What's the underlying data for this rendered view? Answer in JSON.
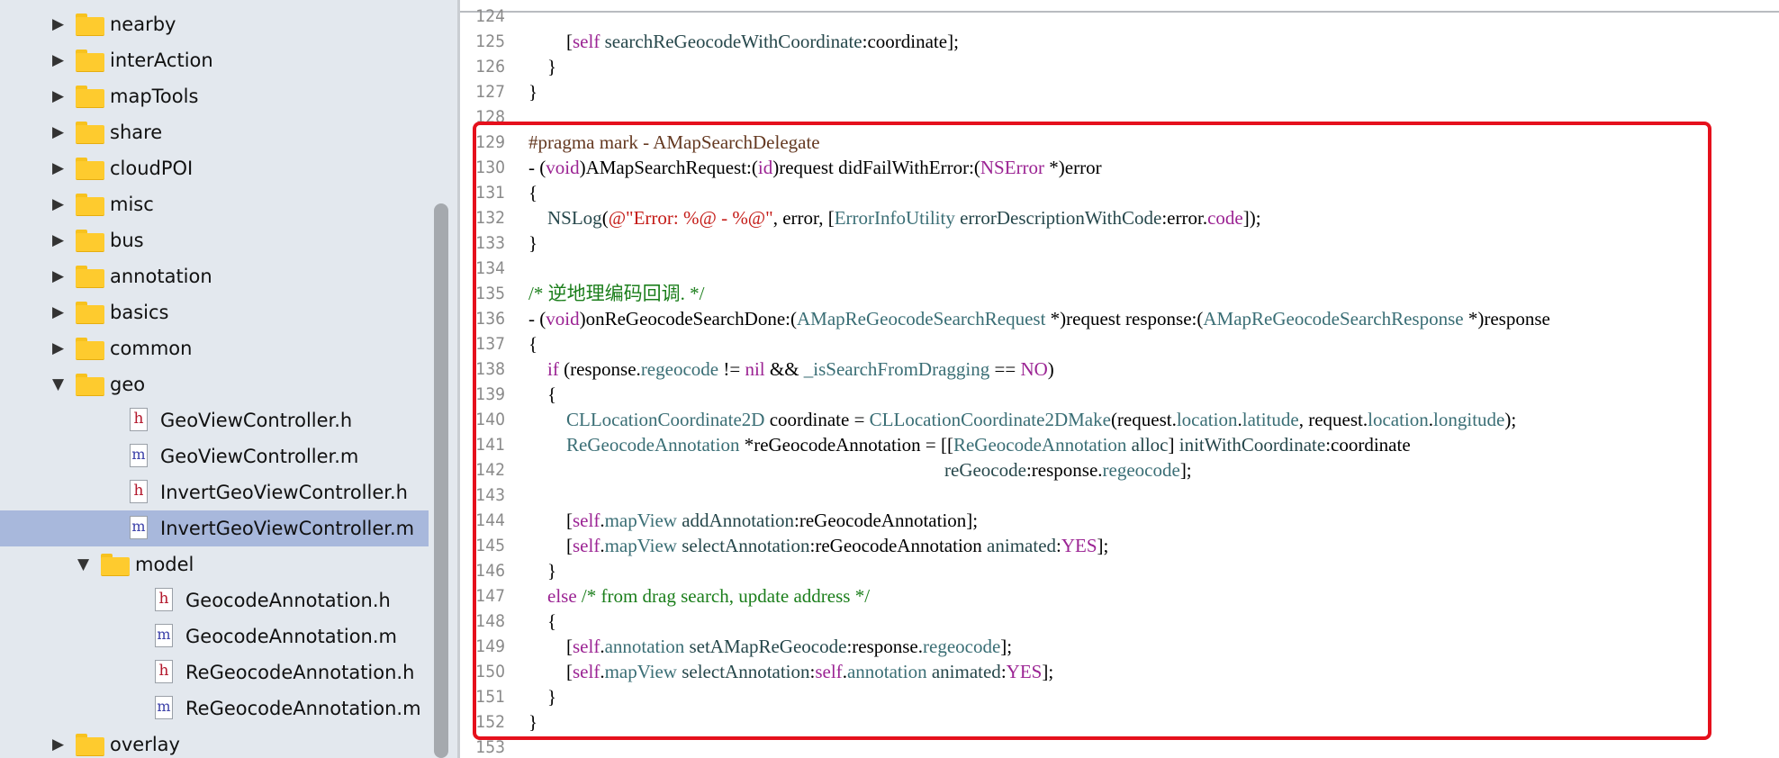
{
  "sidebar": {
    "items": [
      {
        "type": "folder",
        "label": "nearby",
        "expanded": false,
        "depth": 0
      },
      {
        "type": "folder",
        "label": "interAction",
        "expanded": false,
        "depth": 0
      },
      {
        "type": "folder",
        "label": "mapTools",
        "expanded": false,
        "depth": 0
      },
      {
        "type": "folder",
        "label": "share",
        "expanded": false,
        "depth": 0
      },
      {
        "type": "folder",
        "label": "cloudPOI",
        "expanded": false,
        "depth": 0
      },
      {
        "type": "folder",
        "label": "misc",
        "expanded": false,
        "depth": 0
      },
      {
        "type": "folder",
        "label": "bus",
        "expanded": false,
        "depth": 0
      },
      {
        "type": "folder",
        "label": "annotation",
        "expanded": false,
        "depth": 0
      },
      {
        "type": "folder",
        "label": "basics",
        "expanded": false,
        "depth": 0
      },
      {
        "type": "folder",
        "label": "common",
        "expanded": false,
        "depth": 0
      },
      {
        "type": "folder",
        "label": "geo",
        "expanded": true,
        "depth": 0
      },
      {
        "type": "file",
        "icon": "h",
        "label": "GeoViewController.h",
        "depth": 1
      },
      {
        "type": "file",
        "icon": "m",
        "label": "GeoViewController.m",
        "depth": 1
      },
      {
        "type": "file",
        "icon": "h",
        "label": "InvertGeoViewController.h",
        "depth": 1
      },
      {
        "type": "file",
        "icon": "m",
        "label": "InvertGeoViewController.m",
        "depth": 1,
        "selected": true
      },
      {
        "type": "folder",
        "label": "model",
        "expanded": true,
        "depth": 1
      },
      {
        "type": "file",
        "icon": "h",
        "label": "GeocodeAnnotation.h",
        "depth": 2
      },
      {
        "type": "file",
        "icon": "m",
        "label": "GeocodeAnnotation.m",
        "depth": 2
      },
      {
        "type": "file",
        "icon": "h",
        "label": "ReGeocodeAnnotation.h",
        "depth": 2
      },
      {
        "type": "file",
        "icon": "m",
        "label": "ReGeocodeAnnotation.m",
        "depth": 2
      },
      {
        "type": "folder",
        "label": "overlay",
        "expanded": false,
        "depth": 0
      }
    ]
  },
  "editor": {
    "lines": [
      {
        "n": "124",
        "tokens": []
      },
      {
        "n": "125",
        "tokens": [
          [
            "p",
            "        ["
          ],
          [
            "k",
            "self"
          ],
          [
            "p",
            " "
          ],
          [
            "f",
            "searchReGeocodeWithCoordinate"
          ],
          [
            "p",
            ":coordinate];"
          ]
        ]
      },
      {
        "n": "126",
        "tokens": [
          [
            "p",
            "    }"
          ]
        ]
      },
      {
        "n": "127",
        "tokens": [
          [
            "p",
            "}"
          ]
        ]
      },
      {
        "n": "128",
        "tokens": []
      },
      {
        "n": "129",
        "tokens": [
          [
            "r",
            "#pragma mark - AMapSearchDelegate"
          ]
        ]
      },
      {
        "n": "130",
        "tokens": [
          [
            "p",
            "- ("
          ],
          [
            "k",
            "void"
          ],
          [
            "p",
            ")AMapSearchRequest:("
          ],
          [
            "k",
            "id"
          ],
          [
            "p",
            ")request didFailWithError:("
          ],
          [
            "k",
            "NSError"
          ],
          [
            "p",
            " *)error"
          ]
        ]
      },
      {
        "n": "131",
        "tokens": [
          [
            "p",
            "{"
          ]
        ]
      },
      {
        "n": "132",
        "tokens": [
          [
            "p",
            "    "
          ],
          [
            "f",
            "NSLog"
          ],
          [
            "p",
            "("
          ],
          [
            "s",
            "@\"Error: %@ - %@\""
          ],
          [
            "p",
            ", error, ["
          ],
          [
            "c",
            "ErrorInfoUtility"
          ],
          [
            "p",
            " "
          ],
          [
            "f",
            "errorDescriptionWithCode"
          ],
          [
            "p",
            ":error."
          ],
          [
            "k",
            "code"
          ],
          [
            "p",
            "]);"
          ]
        ]
      },
      {
        "n": "133",
        "tokens": [
          [
            "p",
            "}"
          ]
        ]
      },
      {
        "n": "134",
        "tokens": []
      },
      {
        "n": "135",
        "tokens": [
          [
            "m",
            "/* 逆地理编码回调. */"
          ]
        ]
      },
      {
        "n": "136",
        "tokens": [
          [
            "p",
            "- ("
          ],
          [
            "k",
            "void"
          ],
          [
            "p",
            ")onReGeocodeSearchDone:("
          ],
          [
            "c",
            "AMapReGeocodeSearchRequest"
          ],
          [
            "p",
            " *)request response:("
          ],
          [
            "c",
            "AMapReGeocodeSearchResponse"
          ],
          [
            "p",
            " *)response"
          ]
        ]
      },
      {
        "n": "137",
        "tokens": [
          [
            "p",
            "{"
          ]
        ]
      },
      {
        "n": "138",
        "tokens": [
          [
            "p",
            "    "
          ],
          [
            "k",
            "if"
          ],
          [
            "p",
            " (response."
          ],
          [
            "c",
            "regeocode"
          ],
          [
            "p",
            " != "
          ],
          [
            "k",
            "nil"
          ],
          [
            "p",
            " && "
          ],
          [
            "c",
            "_isSearchFromDragging"
          ],
          [
            "p",
            " == "
          ],
          [
            "k",
            "NO"
          ],
          [
            "p",
            ")"
          ]
        ]
      },
      {
        "n": "139",
        "tokens": [
          [
            "p",
            "    {"
          ]
        ]
      },
      {
        "n": "140",
        "tokens": [
          [
            "p",
            "        "
          ],
          [
            "c",
            "CLLocationCoordinate2D"
          ],
          [
            "p",
            " coordinate = "
          ],
          [
            "c",
            "CLLocationCoordinate2DMake"
          ],
          [
            "p",
            "(request."
          ],
          [
            "c",
            "location"
          ],
          [
            "p",
            "."
          ],
          [
            "c",
            "latitude"
          ],
          [
            "p",
            ", request."
          ],
          [
            "c",
            "location"
          ],
          [
            "p",
            "."
          ],
          [
            "c",
            "longitude"
          ],
          [
            "p",
            ");"
          ]
        ]
      },
      {
        "n": "141",
        "tokens": [
          [
            "p",
            "        "
          ],
          [
            "c",
            "ReGeocodeAnnotation"
          ],
          [
            "p",
            " *reGeocodeAnnotation = [["
          ],
          [
            "c",
            "ReGeocodeAnnotation"
          ],
          [
            "p",
            " "
          ],
          [
            "f",
            "alloc"
          ],
          [
            "p",
            "] "
          ],
          [
            "f",
            "initWithCoordinate"
          ],
          [
            "p",
            ":coordinate"
          ]
        ]
      },
      {
        "n": "142",
        "tokens": [
          [
            "p",
            "                                                                                        "
          ],
          [
            "f",
            "reGeocode"
          ],
          [
            "p",
            ":response."
          ],
          [
            "c",
            "regeocode"
          ],
          [
            "p",
            "];"
          ]
        ]
      },
      {
        "n": "143",
        "tokens": []
      },
      {
        "n": "144",
        "tokens": [
          [
            "p",
            "        ["
          ],
          [
            "k",
            "self"
          ],
          [
            "p",
            "."
          ],
          [
            "c",
            "mapView"
          ],
          [
            "p",
            " "
          ],
          [
            "f",
            "addAnnotation"
          ],
          [
            "p",
            ":reGeocodeAnnotation];"
          ]
        ]
      },
      {
        "n": "145",
        "tokens": [
          [
            "p",
            "        ["
          ],
          [
            "k",
            "self"
          ],
          [
            "p",
            "."
          ],
          [
            "c",
            "mapView"
          ],
          [
            "p",
            " "
          ],
          [
            "f",
            "selectAnnotation"
          ],
          [
            "p",
            ":reGeocodeAnnotation "
          ],
          [
            "f",
            "animated"
          ],
          [
            "p",
            ":"
          ],
          [
            "k",
            "YES"
          ],
          [
            "p",
            "];"
          ]
        ]
      },
      {
        "n": "146",
        "tokens": [
          [
            "p",
            "    }"
          ]
        ]
      },
      {
        "n": "147",
        "tokens": [
          [
            "p",
            "    "
          ],
          [
            "k",
            "else"
          ],
          [
            "p",
            " "
          ],
          [
            "m",
            "/* from drag search, update address */"
          ]
        ]
      },
      {
        "n": "148",
        "tokens": [
          [
            "p",
            "    {"
          ]
        ]
      },
      {
        "n": "149",
        "tokens": [
          [
            "p",
            "        ["
          ],
          [
            "k",
            "self"
          ],
          [
            "p",
            "."
          ],
          [
            "c",
            "annotation"
          ],
          [
            "p",
            " "
          ],
          [
            "f",
            "setAMapReGeocode"
          ],
          [
            "p",
            ":response."
          ],
          [
            "c",
            "regeocode"
          ],
          [
            "p",
            "];"
          ]
        ]
      },
      {
        "n": "150",
        "tokens": [
          [
            "p",
            "        ["
          ],
          [
            "k",
            "self"
          ],
          [
            "p",
            "."
          ],
          [
            "c",
            "mapView"
          ],
          [
            "p",
            " "
          ],
          [
            "f",
            "selectAnnotation"
          ],
          [
            "p",
            ":"
          ],
          [
            "k",
            "self"
          ],
          [
            "p",
            "."
          ],
          [
            "c",
            "annotation"
          ],
          [
            "p",
            " "
          ],
          [
            "f",
            "animated"
          ],
          [
            "p",
            ":"
          ],
          [
            "k",
            "YES"
          ],
          [
            "p",
            "];"
          ]
        ]
      },
      {
        "n": "151",
        "tokens": [
          [
            "p",
            "    }"
          ]
        ]
      },
      {
        "n": "152",
        "tokens": [
          [
            "p",
            "}"
          ]
        ]
      },
      {
        "n": "153",
        "tokens": []
      }
    ]
  },
  "colors": {
    "sidebar_bg": "#e3e8ee",
    "selection_bg": "#a8b8dc",
    "highlight_border": "#e5101c",
    "keyword": "#9b2393",
    "class": "#3a6e75",
    "string": "#c41a16",
    "comment": "#1b7e1b",
    "preprocessor": "#643820"
  }
}
